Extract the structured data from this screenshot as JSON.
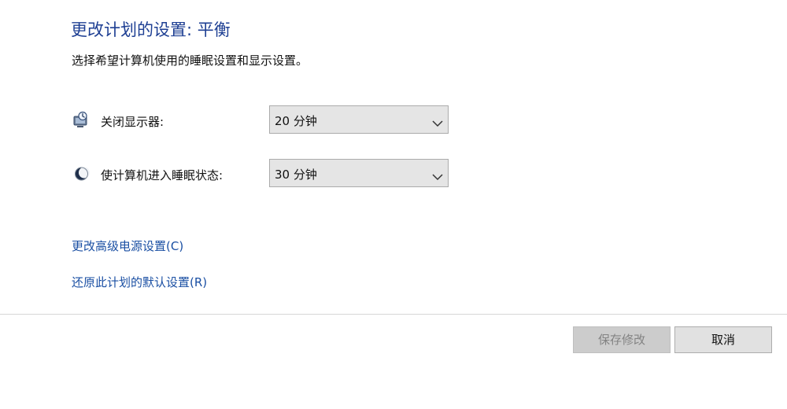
{
  "header": {
    "title": "更改计划的设置: 平衡",
    "subtitle": "选择希望计算机使用的睡眠设置和显示设置。"
  },
  "settings": [
    {
      "icon": "monitor-clock-icon",
      "label": "关闭显示器:",
      "value": "20 分钟"
    },
    {
      "icon": "moon-sleep-icon",
      "label": "使计算机进入睡眠状态:",
      "value": "30 分钟"
    }
  ],
  "links": {
    "advanced": "更改高级电源设置(C)",
    "restore": "还原此计划的默认设置(R)"
  },
  "buttons": {
    "save": "保存修改",
    "cancel": "取消"
  },
  "colors": {
    "title": "#1e3f93",
    "link": "#1a4fa3",
    "dropdown_background": "#e5e5e5"
  }
}
